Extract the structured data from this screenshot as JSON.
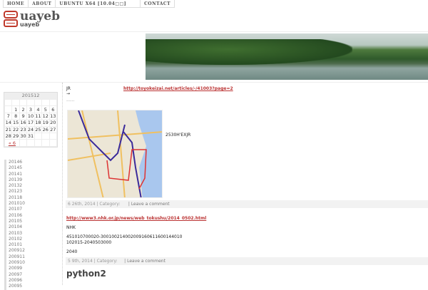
{
  "nav": [
    "HOME",
    "ABOUT",
    "UBUNTU X64 [10.04□□]",
    "CONTACT"
  ],
  "site": {
    "title": "uayeb",
    "subtitle": "uayeb"
  },
  "calendar": {
    "caption": "201512",
    "rows": [
      [
        "",
        "1",
        "2",
        "3",
        "4",
        "5",
        "6"
      ],
      [
        "7",
        "8",
        "9",
        "10",
        "11",
        "12",
        "13"
      ],
      [
        "14",
        "15",
        "16",
        "17",
        "18",
        "19",
        "20"
      ],
      [
        "21",
        "22",
        "23",
        "24",
        "25",
        "26",
        "27"
      ],
      [
        "28",
        "29",
        "30",
        "31",
        "",
        "",
        ""
      ]
    ],
    "prev": "« 6"
  },
  "archives": [
    "20146",
    "20145",
    "20141",
    "20139",
    "20132",
    "20123",
    "20118",
    "201010",
    "20107",
    "20106",
    "20105",
    "20104",
    "20103",
    "20102",
    "20101",
    "200912",
    "200911",
    "200910",
    "20099",
    "20097",
    "20096",
    "20095"
  ],
  "post1": {
    "line1": "JR",
    "arrow": "→",
    "dots": "......",
    "link": "http://toyokeizai.net/articles/-/41003?page=2",
    "caption": "2530H'EXJR",
    "meta_date": "6 26th, 2014 | Category:",
    "meta_comment": "| Leave a comment"
  },
  "post2": {
    "link": "http://www3.nhk.or.jp/news/web_tokushu/2014_0502.html",
    "p1": "NHK",
    "p2a": "451010700020-30010021400200916061160014401​0",
    "p2b": "102015-2040503000",
    "p3": "2040",
    "meta_date": "5 9th, 2014 | Category:",
    "meta_comment": "| Leave a comment"
  },
  "post3": {
    "title": "python2"
  }
}
